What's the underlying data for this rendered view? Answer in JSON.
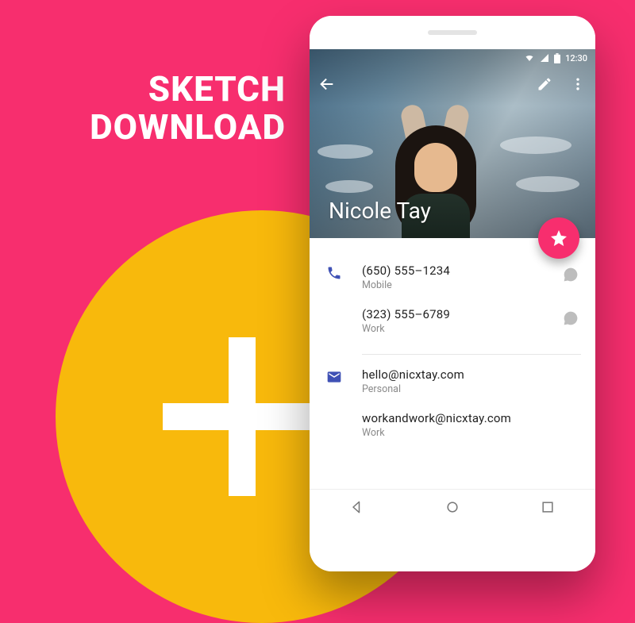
{
  "promo": {
    "headline_line1": "SKETCH",
    "headline_line2": "DOWNLOAD"
  },
  "statusbar": {
    "time": "12:30"
  },
  "contact": {
    "name": "Nicole Tay"
  },
  "phones": [
    {
      "number": "(650) 555–1234",
      "label": "Mobile"
    },
    {
      "number": "(323) 555–6789",
      "label": "Work"
    }
  ],
  "emails": [
    {
      "address": "hello@nicxtay.com",
      "label": "Personal"
    },
    {
      "address": "workandwork@nicxtay.com",
      "label": "Work"
    }
  ],
  "colors": {
    "accent": "#f72e6e",
    "secondary": "#f8b90c",
    "link": "#3f51b5"
  }
}
